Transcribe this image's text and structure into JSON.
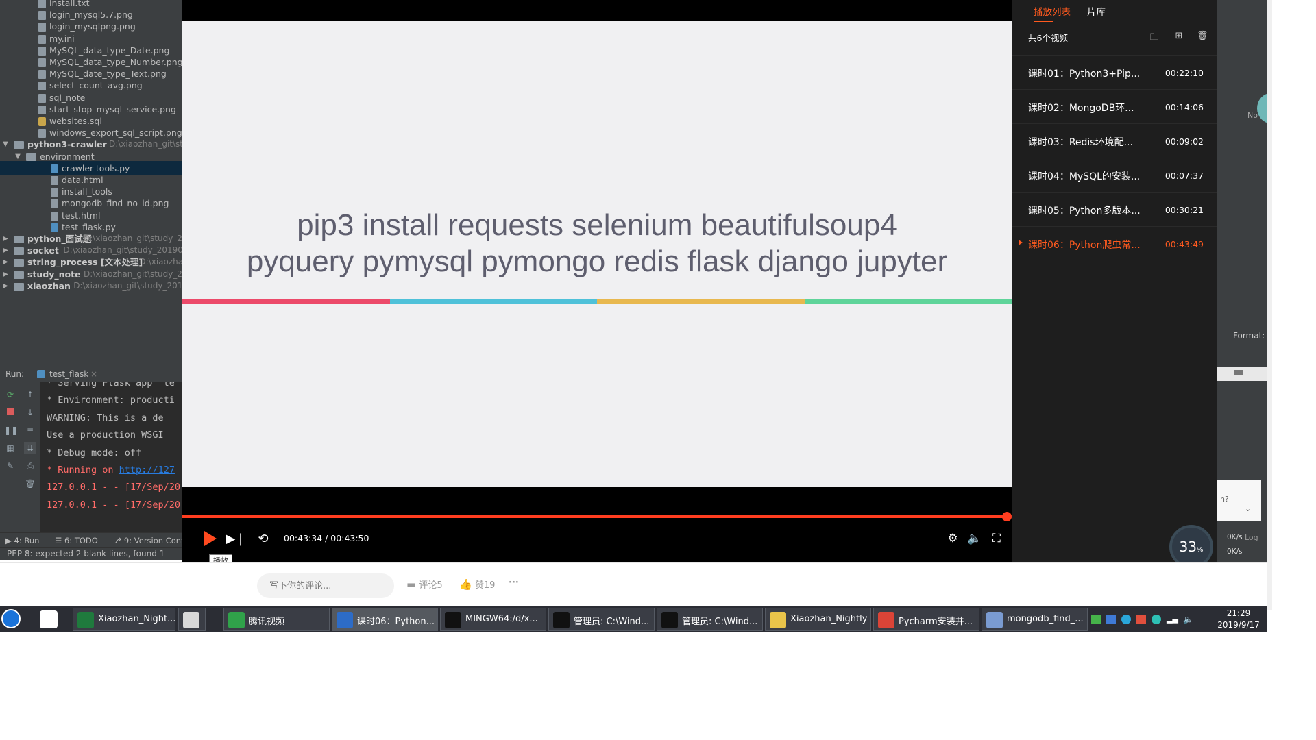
{
  "ide": {
    "tree": [
      {
        "type": "file",
        "label": "install.txt",
        "indent": 2
      },
      {
        "type": "file",
        "label": "login_mysql5.7.png",
        "indent": 2
      },
      {
        "type": "file",
        "label": "login_mysqlpng.png",
        "indent": 2
      },
      {
        "type": "file",
        "label": "my.ini",
        "indent": 2
      },
      {
        "type": "file",
        "label": "MySQL_data_type_Date.png",
        "indent": 2
      },
      {
        "type": "file",
        "label": "MySQL_data_type_Number.png",
        "indent": 2
      },
      {
        "type": "file",
        "label": "MySQL_date_type_Text.png",
        "indent": 2
      },
      {
        "type": "file",
        "label": "select_count_avg.png",
        "indent": 2
      },
      {
        "type": "file",
        "label": "sql_note",
        "indent": 2
      },
      {
        "type": "file",
        "label": "start_stop_mysql_service.png",
        "indent": 2
      },
      {
        "type": "sql",
        "label": "websites.sql",
        "indent": 2
      },
      {
        "type": "file",
        "label": "windows_export_sql_script.png",
        "indent": 2
      },
      {
        "type": "folder",
        "label": "python3-crawler",
        "path": "D:\\xiaozhan_git\\stud",
        "indent": 0,
        "expanded": true
      },
      {
        "type": "folder",
        "label": "environment",
        "indent": 1,
        "expanded": true,
        "plain": true
      },
      {
        "type": "py",
        "label": "crawler-tools.py",
        "indent": 3,
        "selected": true
      },
      {
        "type": "file",
        "label": "data.html",
        "indent": 3
      },
      {
        "type": "file",
        "label": "install_tools",
        "indent": 3
      },
      {
        "type": "file",
        "label": "mongodb_find_no_id.png",
        "indent": 3
      },
      {
        "type": "file",
        "label": "test.html",
        "indent": 3
      },
      {
        "type": "py",
        "label": "test_flask.py",
        "indent": 3
      },
      {
        "type": "folder",
        "label": "python_面试题",
        "path": "D:\\xiaozhan_git\\study_2",
        "indent": 0
      },
      {
        "type": "folder",
        "label": "socket",
        "path": "D:\\xiaozhan_git\\study_2019060",
        "indent": 0
      },
      {
        "type": "folder",
        "label": "string_process [文本处理]",
        "path": "D:\\xiaozhan_",
        "indent": 0
      },
      {
        "type": "folder",
        "label": "study_note",
        "path": "D:\\xiaozhan_git\\study_201",
        "indent": 0
      },
      {
        "type": "folder",
        "label": "xiaozhan",
        "path": "D:\\xiaozhan_git\\study_2019C",
        "indent": 0
      }
    ],
    "run_label": "Run:",
    "run_tab": "test_flask",
    "console": [
      {
        "text": " * Serving Flask app \"te",
        "red": false
      },
      {
        "text": " * Environment: producti",
        "red": false
      },
      {
        "text": "   WARNING: This is a de",
        "red": false
      },
      {
        "text": "   Use a production WSGI",
        "red": false
      },
      {
        "text": " * Debug mode: off",
        "red": false
      },
      {
        "text": " * Running on ",
        "red": true,
        "link": "http://127"
      },
      {
        "text": "127.0.0.1 - - [17/Sep/20",
        "red": true
      },
      {
        "text": "127.0.0.1 - - [17/Sep/20",
        "red": true
      }
    ],
    "bottom_tabs": [
      "4: Run",
      "6: TODO",
      "9: Version Contr"
    ],
    "status": "PEP 8: expected 2 blank lines, found 1"
  },
  "player": {
    "slide_line1": "pip3 install requests selenium beautifulsoup4",
    "slide_line2": "pyquery pymysql pymongo redis flask django jupyter",
    "progress": 0.9943,
    "time": "00:43:34 / 00:43:50",
    "play_tooltip": "播放",
    "stripe_colors": [
      "#ec4a6a",
      "#4fc1d9",
      "#e8b84f",
      "#5fd49a"
    ]
  },
  "playlist": {
    "tabs": [
      "播放列表",
      "片库"
    ],
    "count": "共6个视频",
    "items": [
      {
        "title": "课时01：Python3+Pip...",
        "duration": "00:22:10"
      },
      {
        "title": "课时02：MongoDB环...",
        "duration": "00:14:06"
      },
      {
        "title": "课时03：Redis环境配...",
        "duration": "00:09:02"
      },
      {
        "title": "课时04：MySQL的安装...",
        "duration": "00:07:37"
      },
      {
        "title": "课时05：Python多版本...",
        "duration": "00:30:21"
      },
      {
        "title": "课时06：Python爬虫常...",
        "duration": "00:43:49",
        "current": true
      }
    ],
    "accent": "#ff5a1f"
  },
  "bg_right": {
    "label_no": "No",
    "label_format": "Format:",
    "label_n": "n?",
    "label_log": "Log"
  },
  "net": {
    "percent": "33",
    "percent_unit": "%",
    "up": "0K/s",
    "down": "0K/s"
  },
  "comments": {
    "placeholder": "写下你的评论...",
    "comment_btn": "评论5",
    "like_btn": "赞19",
    "more": "···"
  },
  "taskbar": {
    "items": [
      {
        "label": "Xiaozhan_Night...",
        "icon_color": "#1f7a3d"
      },
      {
        "label": "",
        "icon_color": "#d8d8d8"
      },
      {
        "label": "腾讯视频",
        "icon_color": "#30a24a"
      },
      {
        "label": "课时06：Python...",
        "icon_color": "#2d6cc7",
        "active": true
      },
      {
        "label": "MINGW64:/d/x...",
        "icon_color": "#111111"
      },
      {
        "label": "管理员: C:\\Wind...",
        "icon_color": "#111111"
      },
      {
        "label": "管理员: C:\\Wind...",
        "icon_color": "#111111"
      },
      {
        "label": "Xiaozhan_Nightly",
        "icon_color": "#e9c44a"
      },
      {
        "label": "Pycharm安装并...",
        "icon_color": "#db4437"
      },
      {
        "label": "mongodb_find_...",
        "icon_color": "#7a9bd1"
      }
    ],
    "time": "21:29",
    "date": "2019/9/17"
  }
}
